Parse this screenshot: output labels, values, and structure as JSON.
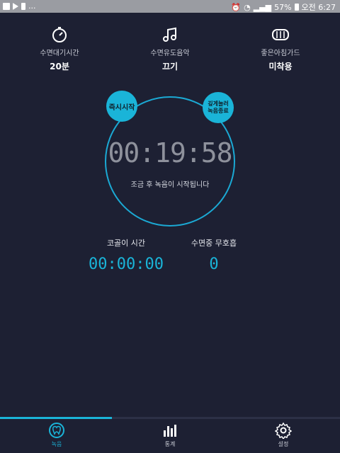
{
  "status_bar": {
    "left_text": "...",
    "battery": "57%",
    "time": "오전 6:27"
  },
  "top": {
    "items": [
      {
        "label": "수면대기시간",
        "value": "20분",
        "icon": "stopwatch-icon"
      },
      {
        "label": "수면유도음악",
        "value": "끄기",
        "icon": "music-note-icon"
      },
      {
        "label": "좋은아침가드",
        "value": "미착용",
        "icon": "mouthguard-icon"
      }
    ]
  },
  "buttons": {
    "start_now": "즉시시작",
    "wake_line1": "깊게눌러",
    "wake_line2": "녹음종료"
  },
  "timer": {
    "value": "00:19:58",
    "subtitle": "조금 후 녹음이 시작됩니다"
  },
  "stats": {
    "snore_label": "코골이 시간",
    "snore_value": "00:00:00",
    "apnea_label": "수면중 무호흡",
    "apnea_value": "0"
  },
  "progress": {
    "fraction": 0.33
  },
  "nav": {
    "items": [
      {
        "label": "녹음",
        "icon": "tooth-icon",
        "active": true
      },
      {
        "label": "통계",
        "icon": "bar-chart-icon",
        "active": false
      },
      {
        "label": "설정",
        "icon": "gear-icon",
        "active": false
      }
    ]
  },
  "colors": {
    "background": "#1d2033",
    "accent": "#1ab4d8"
  }
}
